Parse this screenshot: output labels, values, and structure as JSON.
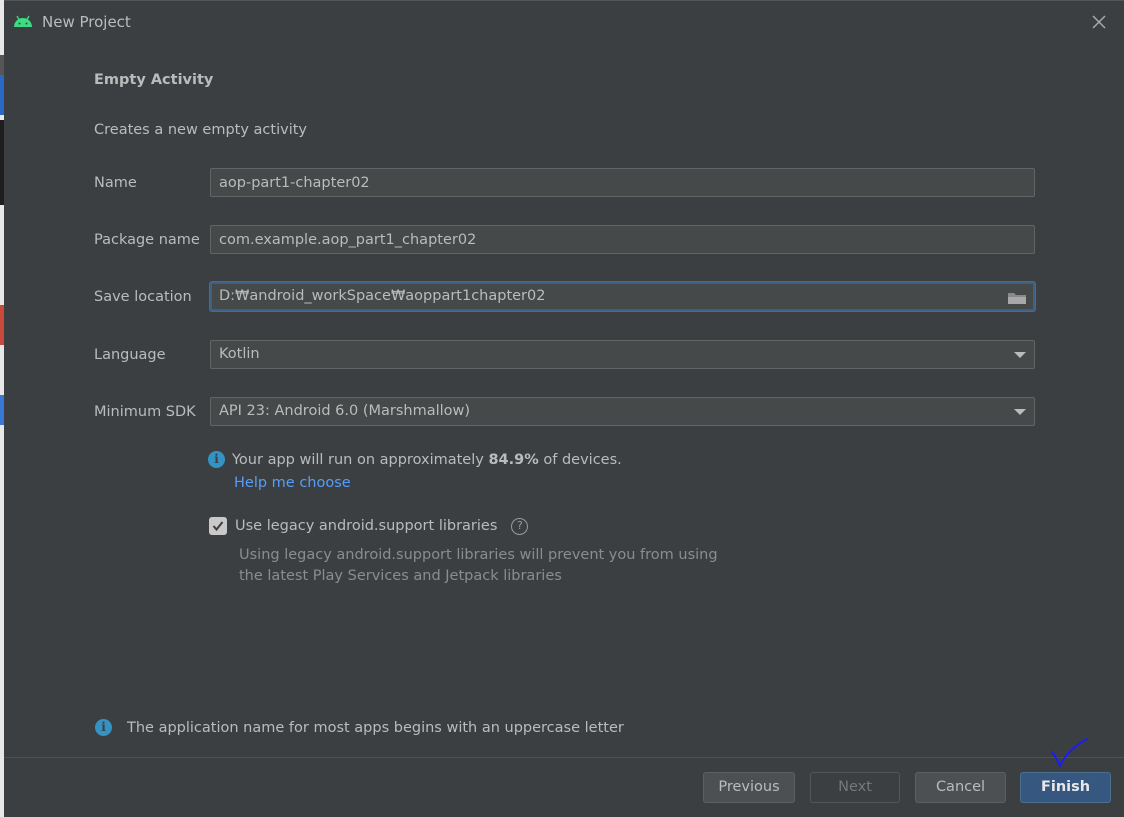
{
  "window": {
    "title": "New Project"
  },
  "page": {
    "heading": "Empty Activity",
    "description": "Creates a new empty activity"
  },
  "form": {
    "name": {
      "label": "Name",
      "value": "aop-part1-chapter02"
    },
    "package_name": {
      "label": "Package name",
      "value": "com.example.aop_part1_chapter02"
    },
    "save_location": {
      "label": "Save location",
      "value": "D:₩android_workSpace₩aoppart1chapter02"
    },
    "language": {
      "label": "Language",
      "value": "Kotlin"
    },
    "minimum_sdk": {
      "label": "Minimum SDK",
      "value": "API 23: Android 6.0 (Marshmallow)"
    }
  },
  "sdk_info": {
    "prefix": "Your app will run on approximately ",
    "percent": "84.9%",
    "suffix": " of devices.",
    "help_link": "Help me choose"
  },
  "legacy": {
    "label": "Use legacy android.support libraries",
    "checked": true,
    "note_line1": "Using legacy android.support libraries will prevent you from using",
    "note_line2": "the latest Play Services and Jetpack libraries"
  },
  "bottom_info": "The application name for most apps begins with an uppercase letter",
  "buttons": {
    "previous": "Previous",
    "next": "Next",
    "cancel": "Cancel",
    "finish": "Finish"
  },
  "colors": {
    "background": "#3c3f41",
    "field": "#45494a",
    "link": "#589df6",
    "primary_button": "#365880",
    "info_icon": "#3592c4",
    "android_green": "#3ddc84",
    "annotation_ink": "#1a1aff"
  },
  "icons": [
    "android-icon",
    "close-icon",
    "folder-icon",
    "chevron-down-icon",
    "info-icon",
    "help-icon",
    "checkmark-icon"
  ]
}
